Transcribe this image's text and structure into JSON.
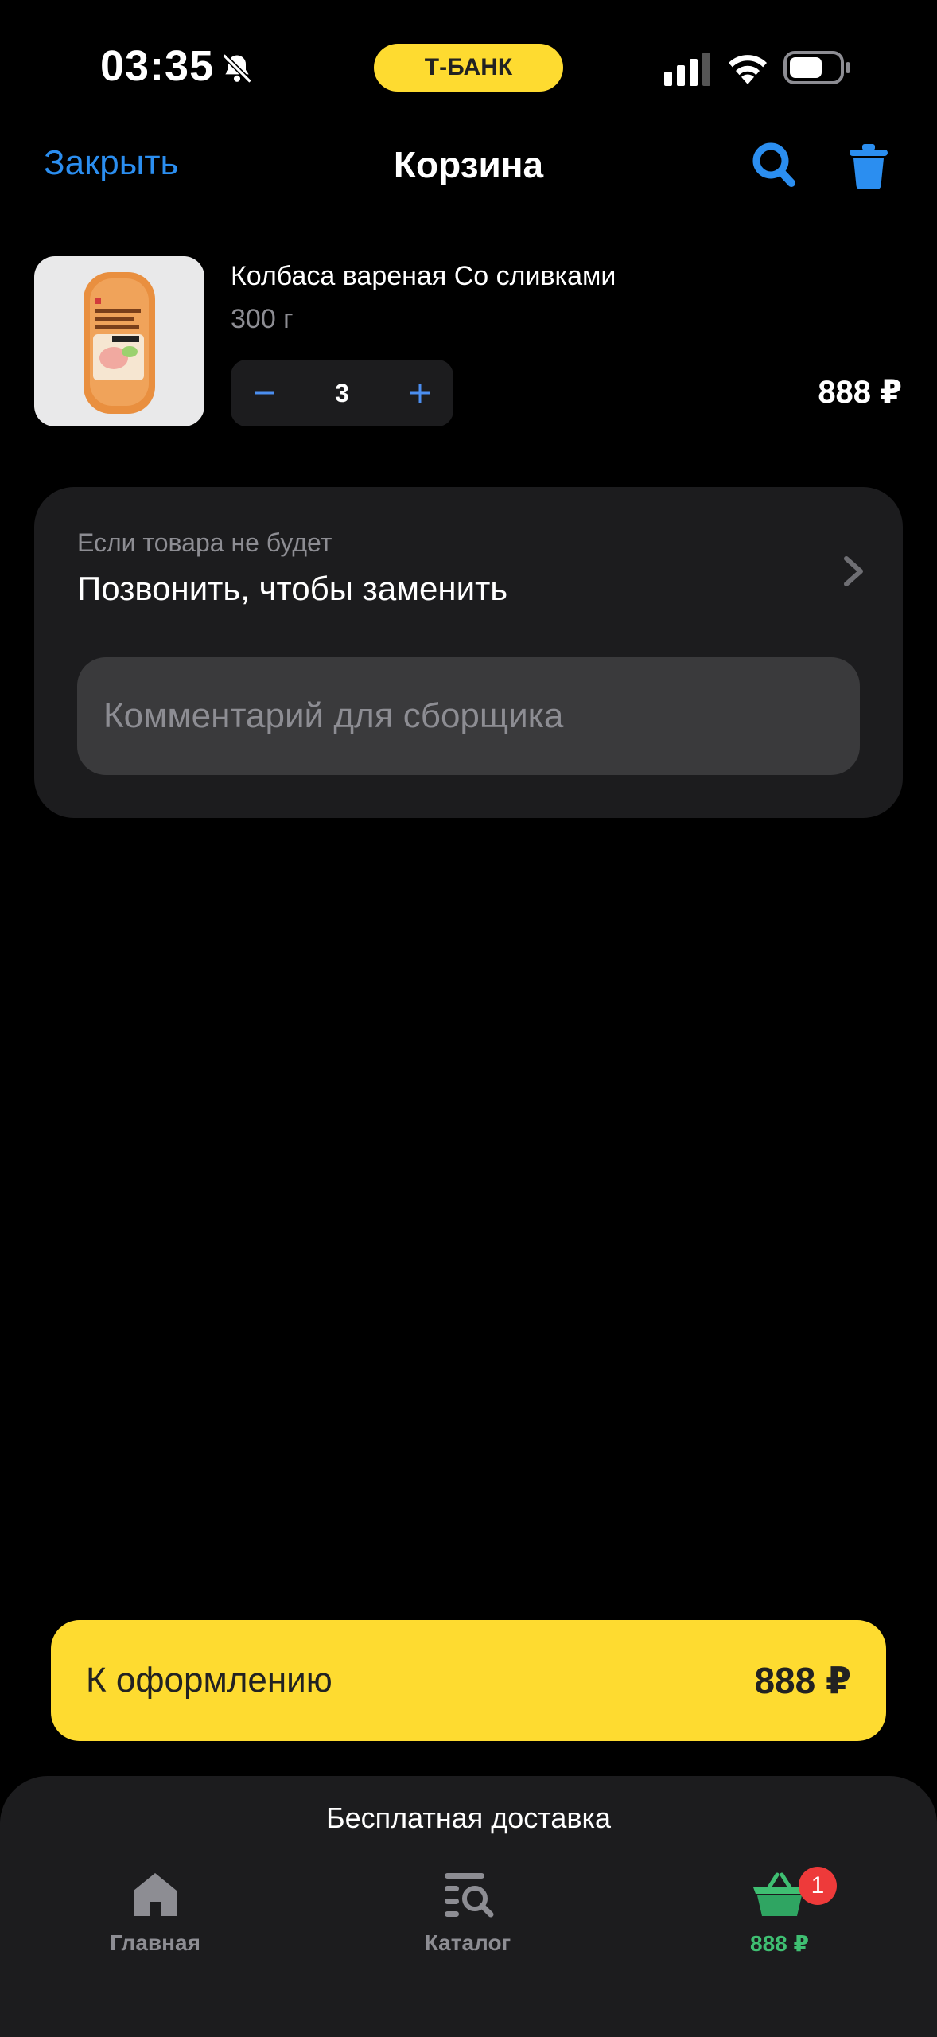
{
  "status_bar": {
    "time": "03:35",
    "bank_label": "Т-БАНК",
    "icons": [
      "bell-slash-icon",
      "signal-icon",
      "wifi-icon",
      "battery-icon"
    ]
  },
  "header": {
    "close_label": "Закрыть",
    "title": "Корзина",
    "icons": [
      "search-icon",
      "trash-icon"
    ]
  },
  "cart_item": {
    "name": "Колбаса вареная Со сливками",
    "weight": "300 г",
    "quantity": "3",
    "price": "888 ₽"
  },
  "options": {
    "missing_label": "Если товара не будет",
    "missing_value": "Позвонить, чтобы заменить",
    "comment_placeholder": "Комментарий для сборщика"
  },
  "checkout": {
    "label": "К оформлению",
    "total": "888 ₽"
  },
  "bottom_nav": {
    "delivery_text": "Бесплатная доставка",
    "items": [
      {
        "label": "Главная",
        "icon": "home-icon"
      },
      {
        "label": "Каталог",
        "icon": "catalog-icon"
      },
      {
        "label": "888 ₽",
        "icon": "basket-icon",
        "badge": "1"
      }
    ]
  },
  "colors": {
    "accent_blue": "#2b8ef0",
    "brand_yellow": "#fedb30",
    "cart_green": "#3fbf72",
    "badge_red": "#ee3a3a"
  }
}
